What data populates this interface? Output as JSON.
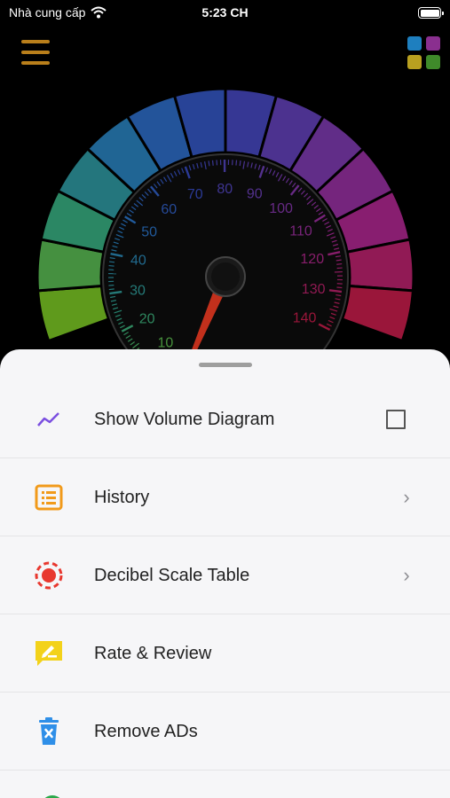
{
  "status_bar": {
    "carrier": "Nhà cung cấp",
    "time": "5:23 CH"
  },
  "gauge": {
    "scale_labels": [
      "10",
      "20",
      "30",
      "40",
      "50",
      "60",
      "70",
      "80",
      "90",
      "100",
      "110",
      "120",
      "130",
      "140"
    ],
    "needle_value": 0
  },
  "colors": {
    "menu_accent": "#b97f1b",
    "sheet_bg": "#f6f6f8",
    "grid": [
      "#1e7fbf",
      "#8a2f8f",
      "#b8a020",
      "#3f8a2a"
    ]
  },
  "menu": {
    "items": [
      {
        "label": "Show Volume Diagram",
        "icon": "trend-line-icon",
        "control": "checkbox",
        "checked": false
      },
      {
        "label": "History",
        "icon": "list-icon",
        "control": "chevron"
      },
      {
        "label": "Decibel Scale Table",
        "icon": "record-target-icon",
        "control": "chevron"
      },
      {
        "label": "Rate & Review",
        "icon": "review-pencil-icon",
        "control": "none"
      },
      {
        "label": "Remove ADs",
        "icon": "trash-x-icon",
        "control": "none"
      }
    ]
  }
}
